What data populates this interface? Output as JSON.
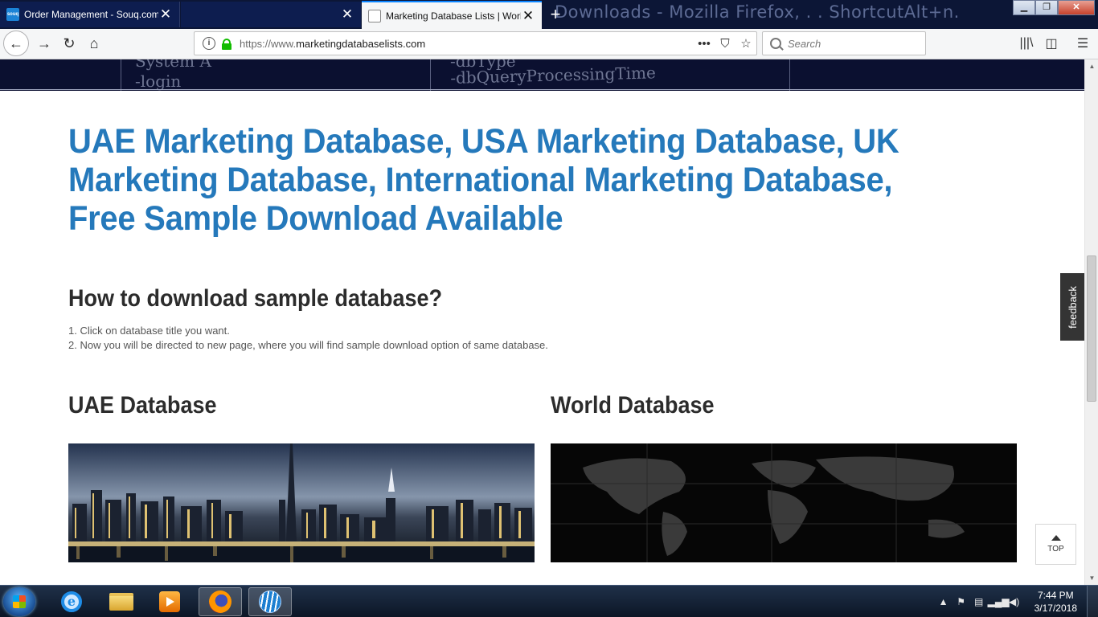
{
  "browser": {
    "tabs": [
      {
        "title": "Order Management - Souq.com"
      },
      {
        "title": ""
      },
      {
        "title": "Marketing Database Lists | World"
      }
    ],
    "background_window_text": "Downloads - Mozilla Firefox, . . ShortcutAlt+n.",
    "url_scheme": "https://www.",
    "url_host": "marketingdatabaselists.com",
    "search_placeholder": "Search"
  },
  "banner": {
    "code_lines": [
      "System A",
      "-login",
      "-dbType",
      "-dbQueryProcessingTime"
    ]
  },
  "page": {
    "title": "UAE Marketing Database, USA Marketing Database, UK Marketing Database, International Marketing Database, Free Sample Download Available",
    "how_to_heading": "How to download sample database?",
    "steps": [
      "1. Click on database title you want.",
      "2. Now you will be directed to new page, where you will find sample download option of same database."
    ],
    "sections": [
      {
        "title": "UAE Database"
      },
      {
        "title": "World Database"
      }
    ],
    "feedback_label": "feedback",
    "top_label": "TOP"
  },
  "taskbar": {
    "time": "7:44 PM",
    "date": "3/17/2018"
  },
  "colors": {
    "title_blue": "#2579bb",
    "heading_dark": "#2c2c2c",
    "tabstrip": "#0c1636"
  }
}
